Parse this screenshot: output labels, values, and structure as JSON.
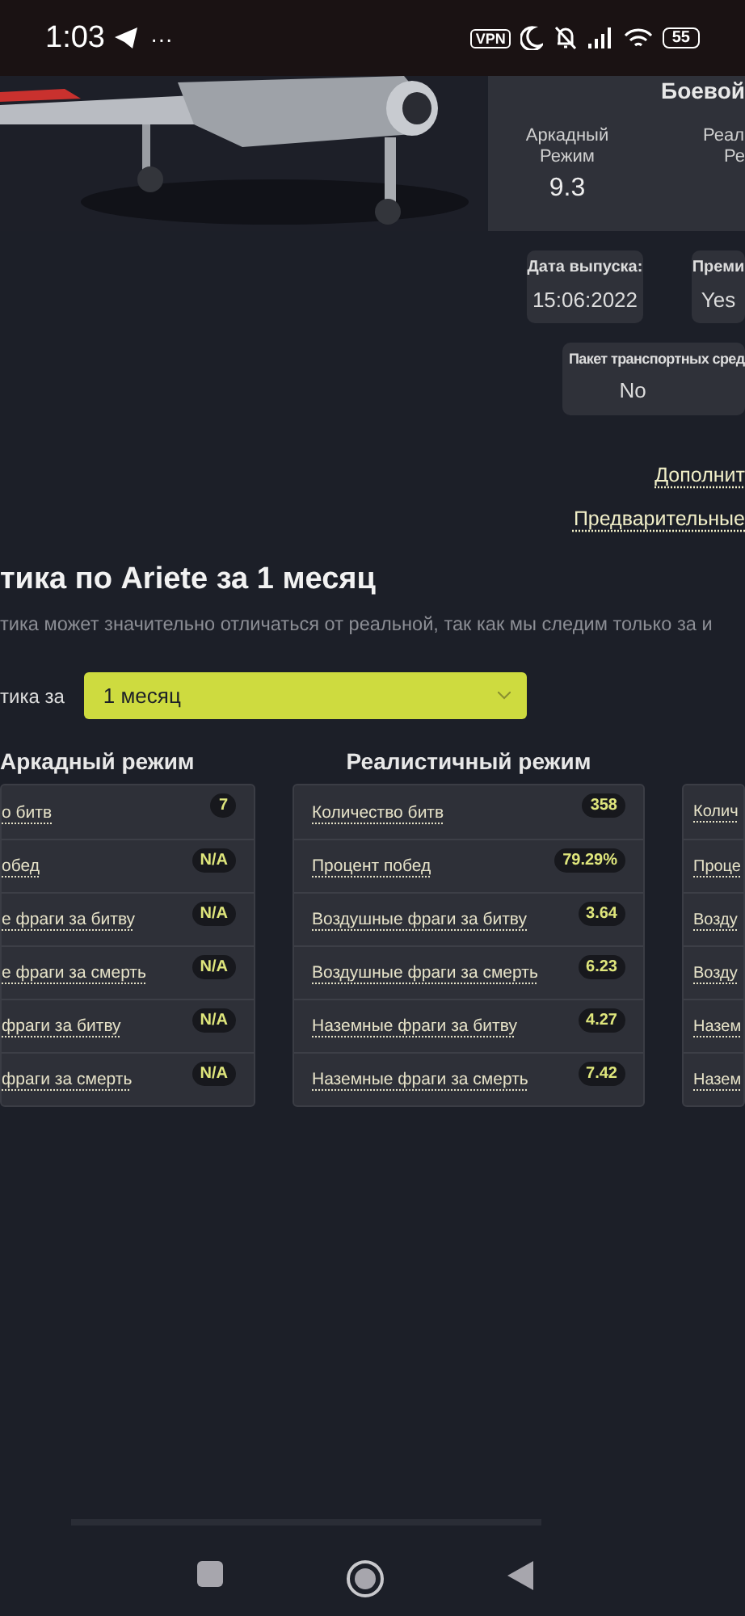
{
  "status_bar": {
    "time": "1:03",
    "more": "···",
    "vpn": "VPN",
    "battery": "55"
  },
  "header_card": {
    "title": "Боевой",
    "modes": [
      {
        "label_lines": [
          "Аркадный",
          "Режим"
        ],
        "value": "9.3"
      },
      {
        "label_lines": [
          "Реал",
          "Ре"
        ]
      }
    ]
  },
  "info_cards": [
    {
      "label": "Дата выпуска:",
      "value": "15:06:2022"
    },
    {
      "label": "Преми",
      "value": "Yes"
    },
    {
      "label": "Пакет транспортных сред",
      "value": "No"
    }
  ],
  "links": [
    "Дополнит",
    "Предварительные"
  ],
  "stats_title": "тика по Ariete за 1 месяц",
  "stats_note": "тика может значительно отличаться от реальной, так как мы следим только за и",
  "period": {
    "label": "тика за",
    "value": "1 месяц"
  },
  "modes": [
    {
      "title": "Аркадный режим",
      "stats": [
        {
          "label": "о битв",
          "value": "7"
        },
        {
          "label": "обед",
          "value": "N/A"
        },
        {
          "label": "е фраги за битву",
          "value": "N/A"
        },
        {
          "label": "е фраги за смерть",
          "value": "N/A"
        },
        {
          "label": "фраги за битву",
          "value": "N/A"
        },
        {
          "label": "фраги за смерть",
          "value": "N/A"
        }
      ]
    },
    {
      "title": "Реалистичный режим",
      "stats": [
        {
          "label": "Количество битв",
          "value": "358"
        },
        {
          "label": "Процент побед",
          "value": "79.29%"
        },
        {
          "label": "Воздушные фраги за битву",
          "value": "3.64"
        },
        {
          "label": "Воздушные фраги за смерть",
          "value": "6.23"
        },
        {
          "label": "Наземные фраги за битву",
          "value": "4.27"
        },
        {
          "label": "Наземные фраги за смерть",
          "value": "7.42"
        }
      ]
    },
    {
      "stats": [
        {
          "label": "Колич"
        },
        {
          "label": "Проце"
        },
        {
          "label": "Возду"
        },
        {
          "label": "Возду"
        },
        {
          "label": "Назем"
        },
        {
          "label": "Назем"
        }
      ]
    }
  ]
}
